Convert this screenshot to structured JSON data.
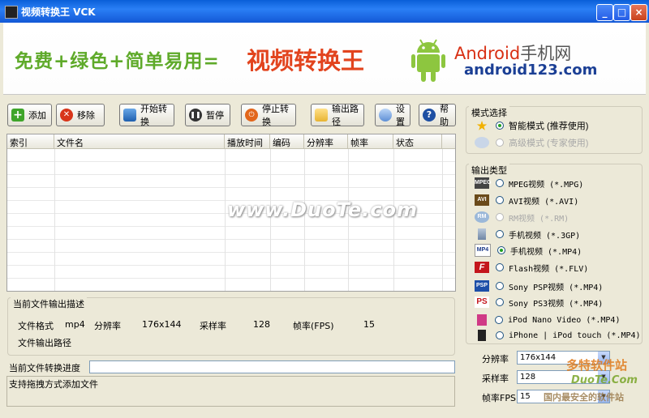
{
  "window": {
    "title": "视频转换王 VCK"
  },
  "banner": {
    "slogan": "免费+绿色+简单易用=",
    "product": "视频转换王",
    "logo_line1_a": "Android",
    "logo_line1_b": "手机网",
    "logo_line2": "android123.com"
  },
  "toolbar": {
    "add": "添加",
    "remove": "移除",
    "start": "开始转换",
    "pause": "暂停",
    "stop": "停止转换",
    "output_path": "输出路径",
    "settings": "设置",
    "help": "帮助"
  },
  "grid": {
    "columns": [
      "索引",
      "文件名",
      "播放时间",
      "编码",
      "分辨率",
      "帧率",
      "状态"
    ]
  },
  "watermark": "www.DuoTe.com",
  "output_desc": {
    "title": "当前文件输出描述",
    "format_label": "文件格式",
    "format_value": "mp4",
    "resolution_label": "分辨率",
    "resolution_value": "176x144",
    "sample_label": "采样率",
    "sample_value": "128",
    "fps_label": "帧率(FPS)",
    "fps_value": "15",
    "path_label": "文件输出路径"
  },
  "progress_label": "当前文件转换进度",
  "status_text": "支持拖拽方式添加文件",
  "mode": {
    "title": "模式选择",
    "smart": "智能模式 (推荐使用)",
    "expert": "高级模式 (专家使用)"
  },
  "output_type": {
    "title": "输出类型",
    "options": [
      "MPEG视频 (*.MPG)",
      "AVI视频 (*.AVI)",
      "RM视频 (*.RM)",
      "手机视频 (*.3GP)",
      "手机视频 (*.MP4)",
      "Flash视频 (*.FLV)",
      "Sony PSP视频 (*.MP4)",
      "Sony PS3视频 (*.MP4)",
      "iPod Nano Video (*.MP4)",
      "iPhone | iPod touch (*.MP4)"
    ],
    "icons": [
      "MPEG",
      "AVI",
      "RM",
      "",
      "MP4",
      "F",
      "PSP",
      "PS",
      "",
      "",
      ""
    ]
  },
  "settings": {
    "resolution_label": "分辨率",
    "resolution_value": "176x144",
    "sample_label": "采样率",
    "sample_value": "128",
    "fps_label": "帧率FPS",
    "fps_value": "15"
  },
  "watermark2": {
    "line1": "多特软件站",
    "line2": "DuoTe.Com",
    "line3": "国内最安全的软件站"
  }
}
